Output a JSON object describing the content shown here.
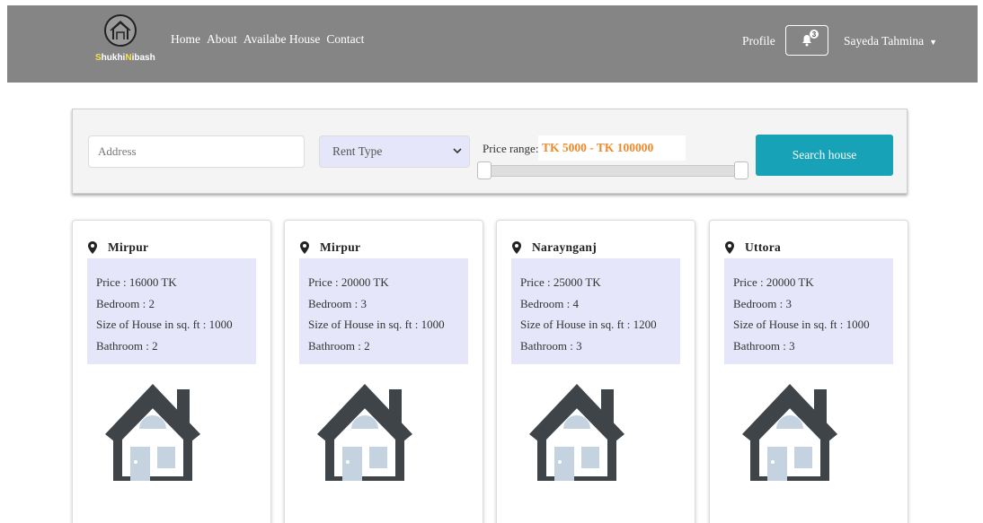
{
  "brand": {
    "prefix_letter": "S",
    "part1": "hukhi",
    "mid_letter": "N",
    "part2": "ibash"
  },
  "nav": {
    "links": [
      "Home",
      "About",
      "Availabe House",
      "Contact"
    ]
  },
  "profile_label": "Profile",
  "notifications": {
    "count": "3",
    "icon": "bell-icon"
  },
  "user": {
    "name": "Sayeda Tahmina"
  },
  "search": {
    "address_placeholder": "Address",
    "rent_type_selected": "Rent Type",
    "price_range_label": "Price range:",
    "price_range_value": "TK 5000 - TK 100000",
    "button_label": "Search house"
  },
  "colors": {
    "navbar": "#858585",
    "accent": "#17a2b8",
    "price": "#f08a2c",
    "info_box": "#e6e6fa",
    "house_outline": "#3f4449",
    "house_fill": "#c5d3e0"
  },
  "cards": [
    {
      "location": "Mirpur",
      "price": "Price : 16000 TK",
      "bedroom": "Bedroom : 2",
      "size": "Size of House in sq. ft : 1000",
      "bathroom": "Bathroom : 2"
    },
    {
      "location": "Mirpur",
      "price": "Price : 20000 TK",
      "bedroom": "Bedroom : 3",
      "size": "Size of House in sq. ft : 1000",
      "bathroom": "Bathroom : 2"
    },
    {
      "location": "Naraynganj",
      "price": "Price : 25000 TK",
      "bedroom": "Bedroom : 4",
      "size": "Size of House in sq. ft : 1200",
      "bathroom": "Bathroom : 3"
    },
    {
      "location": "Uttora",
      "price": "Price : 20000 TK",
      "bedroom": "Bedroom : 3",
      "size": "Size of House in sq. ft : 1000",
      "bathroom": "Bathroom : 3"
    }
  ]
}
